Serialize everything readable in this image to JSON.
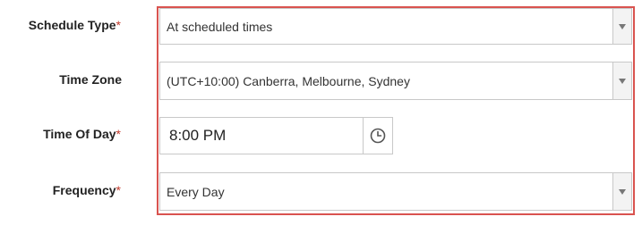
{
  "form": {
    "required_marker": "*",
    "schedule_type": {
      "label": "Schedule Type",
      "value": "At scheduled times"
    },
    "time_zone": {
      "label": "Time Zone",
      "value": "(UTC+10:00) Canberra, Melbourne, Sydney"
    },
    "time_of_day": {
      "label": "Time Of Day",
      "value": "8:00 PM",
      "button_icon": "clock-icon"
    },
    "frequency": {
      "label": "Frequency",
      "value": "Every Day"
    }
  },
  "colors": {
    "highlight_border": "#d9534f",
    "required": "#c0392b"
  }
}
